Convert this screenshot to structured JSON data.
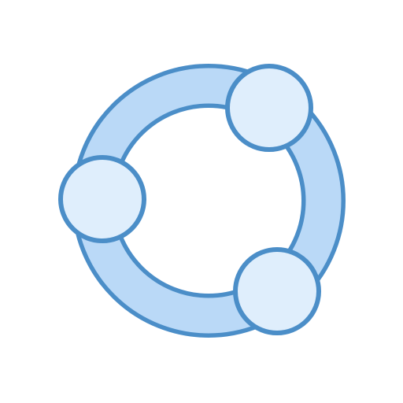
{
  "icon": {
    "semantic_name": "share-network-icon",
    "nodes": [
      {
        "name": "node-top-right"
      },
      {
        "name": "node-left"
      },
      {
        "name": "node-bottom-right"
      }
    ],
    "colors": {
      "background": "#ffffff",
      "ring_fill": "#bad9f7",
      "node_fill": "#dfeefc",
      "stroke": "#4b8ec8"
    }
  }
}
